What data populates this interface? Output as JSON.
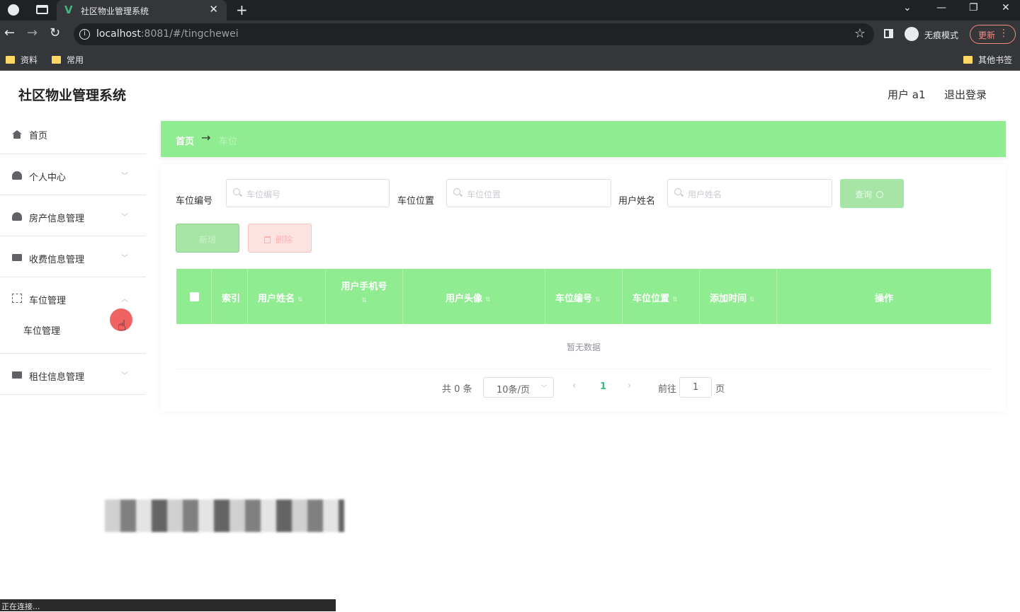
{
  "browser": {
    "tab_title": "社区物业管理系统",
    "tab_close": "✕",
    "new_tab": "+",
    "url_host": "localhost",
    "url_rest": ":8081/#/tingchewei",
    "incognito_label": "无痕模式",
    "update_label": "更新",
    "bookmarks": [
      "资料",
      "常用"
    ],
    "other_bookmarks": "其他书签",
    "status_text": "正在连接..."
  },
  "app": {
    "title": "社区物业管理系统",
    "user": "用户 a1",
    "logout": "退出登录"
  },
  "sidebar": {
    "items": [
      {
        "label": "首页",
        "icon": "home-icon"
      },
      {
        "label": "个人中心",
        "icon": "user-icon"
      },
      {
        "label": "房产信息管理",
        "icon": "user-icon"
      },
      {
        "label": "收费信息管理",
        "icon": "monitor-icon"
      },
      {
        "label": "车位管理",
        "icon": "dashed-square-icon"
      },
      {
        "label": "租住信息管理",
        "icon": "monitor-icon"
      }
    ],
    "submenu": {
      "label": "车位管理"
    }
  },
  "breadcrumb": {
    "home": "首页",
    "arrow": "→",
    "current": "车位"
  },
  "filters": [
    {
      "label": "车位编号",
      "placeholder": "车位编号"
    },
    {
      "label": "车位位置",
      "placeholder": "车位位置"
    },
    {
      "label": "用户姓名",
      "placeholder": "用户姓名"
    }
  ],
  "buttons": {
    "query": "查询",
    "add": "新增",
    "delete": "删除"
  },
  "table": {
    "columns": [
      "索引",
      "用户姓名",
      "用户手机号",
      "用户头像",
      "车位编号",
      "车位位置",
      "添加时间",
      "操作"
    ],
    "sort_mark": "⇅",
    "empty_text": "暂无数据"
  },
  "pagination": {
    "total": "共 0 条",
    "page_size": "10条/页",
    "current_page": "1",
    "goto_prefix": "前往",
    "goto_value": "1",
    "goto_suffix": "页"
  },
  "colors": {
    "accent": "#90ec90",
    "danger": "#fde2e2"
  }
}
